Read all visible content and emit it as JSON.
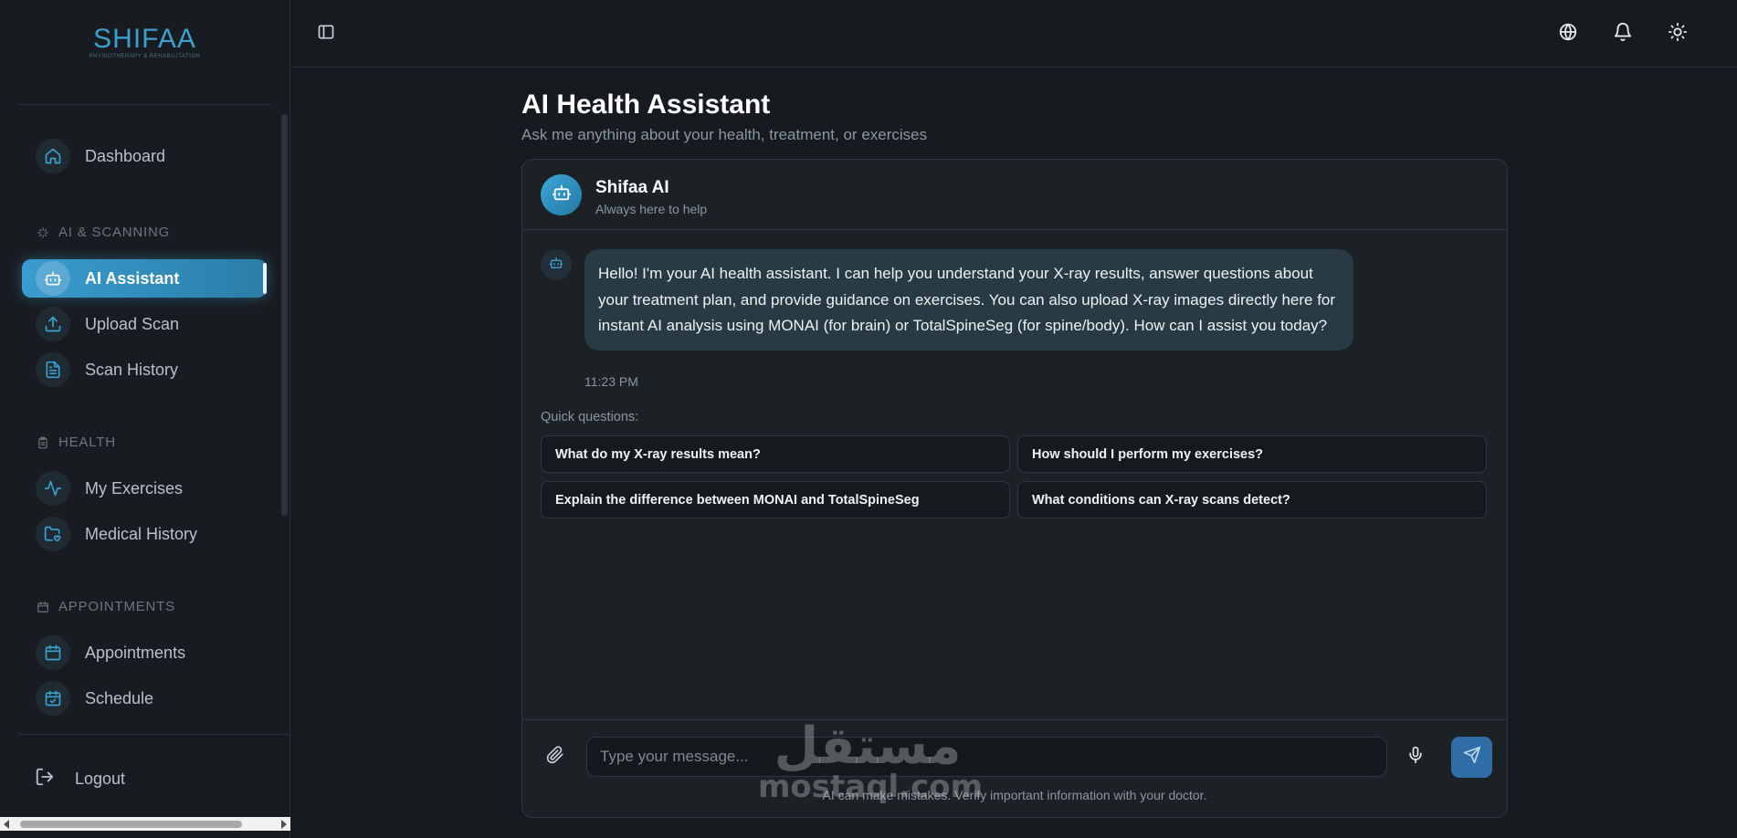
{
  "sidebar": {
    "logo_title": "SHIFAA",
    "logo_subtitle": "PHYSIOTHERAPY & REHABILITATION",
    "items": [
      {
        "label": "Dashboard",
        "icon": "home-icon"
      },
      {
        "label": "AI Assistant",
        "icon": "robot-icon",
        "active": true
      },
      {
        "label": "Upload Scan",
        "icon": "upload-icon"
      },
      {
        "label": "Scan History",
        "icon": "file-text-icon"
      },
      {
        "label": "My Exercises",
        "icon": "activity-icon"
      },
      {
        "label": "Medical History",
        "icon": "folder-heart-icon"
      },
      {
        "label": "Appointments",
        "icon": "calendar-icon"
      },
      {
        "label": "Schedule",
        "icon": "calendar-check-icon"
      }
    ],
    "sections": {
      "ai_scanning": "AI & SCANNING",
      "health": "HEALTH",
      "appointments": "APPOINTMENTS"
    },
    "logout_label": "Logout"
  },
  "topbar": {
    "toggle_icon": "sidebar-toggle-icon",
    "language_icon": "globe-icon",
    "notifications_icon": "bell-icon",
    "theme_icon": "sun-icon"
  },
  "main": {
    "title": "AI Health Assistant",
    "subtitle": "Ask me anything about your health, treatment, or exercises",
    "chat": {
      "bot_name": "Shifaa AI",
      "bot_status": "Always here to help",
      "messages": [
        {
          "text": "Hello! I'm your AI health assistant. I can help you understand your X-ray results, answer questions about your treatment plan, and provide guidance on exercises. You can also upload X-ray images directly here for instant AI analysis using MONAI (for brain) or TotalSpineSeg (for spine/body). How can I assist you today?",
          "time": "11:23 PM"
        }
      ],
      "quick_label": "Quick questions:",
      "quick_questions": [
        "What do my X-ray results mean?",
        "How should I perform my exercises?",
        "Explain the difference between MONAI and TotalSpineSeg",
        "What conditions can X-ray scans detect?"
      ],
      "input_placeholder": "Type your message...",
      "input_value": "",
      "disclaimer": "AI can make mistakes. Verify important information with your doctor."
    }
  },
  "watermark": {
    "arabic": "مستقل",
    "latin": "mostaql.com"
  },
  "colors": {
    "accent": "#3a9ccf",
    "background": "#171b1f",
    "bubble": "#283a44",
    "send_button": "#2f6ea6"
  }
}
